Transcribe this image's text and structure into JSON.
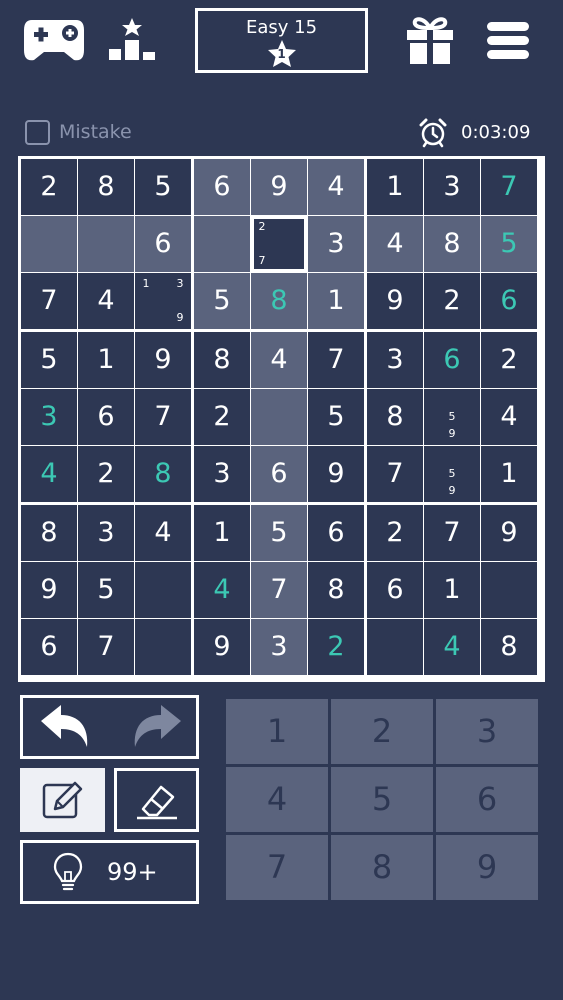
{
  "level": {
    "label": "Easy 15",
    "stars": "1"
  },
  "mistake": {
    "label": "Mistake",
    "checked": false
  },
  "timer": {
    "value": "0:03:09"
  },
  "hint": {
    "count": "99+"
  },
  "numpad": [
    "1",
    "2",
    "3",
    "4",
    "5",
    "6",
    "7",
    "8",
    "9"
  ],
  "icons": [
    "gamepad-icon",
    "leaderboard-icon",
    "gift-icon",
    "menu-icon",
    "alarm-clock-icon",
    "undo-icon",
    "redo-icon",
    "pencil-icon",
    "eraser-icon",
    "lightbulb-icon",
    "star-icon"
  ],
  "colors": {
    "background": "#2d3753",
    "highlight": "#5a637d",
    "user_digit": "#3cc8b4",
    "text": "#ffffff"
  },
  "board": [
    [
      {
        "v": "2"
      },
      {
        "v": "8"
      },
      {
        "v": "5"
      },
      {
        "v": "6",
        "h": 1
      },
      {
        "v": "9",
        "h": 1
      },
      {
        "v": "4",
        "h": 1
      },
      {
        "v": "1"
      },
      {
        "v": "3"
      },
      {
        "v": "7",
        "u": 1
      }
    ],
    [
      {
        "v": "",
        "h": 1
      },
      {
        "v": "",
        "h": 1
      },
      {
        "v": "6",
        "h": 1
      },
      {
        "v": "",
        "h": 1
      },
      {
        "v": "",
        "s": 1,
        "n": [
          "2",
          "",
          "",
          "",
          "",
          "",
          "7",
          "",
          ""
        ]
      },
      {
        "v": "3",
        "h": 1
      },
      {
        "v": "4",
        "h": 1
      },
      {
        "v": "8",
        "h": 1
      },
      {
        "v": "5",
        "u": 1,
        "h": 1
      }
    ],
    [
      {
        "v": "7"
      },
      {
        "v": "4"
      },
      {
        "v": "",
        "n": [
          "1",
          "",
          "3",
          "",
          "",
          "",
          "",
          "",
          "9"
        ]
      },
      {
        "v": "5",
        "h": 1
      },
      {
        "v": "8",
        "u": 1,
        "h": 1
      },
      {
        "v": "1",
        "h": 1
      },
      {
        "v": "9"
      },
      {
        "v": "2"
      },
      {
        "v": "6",
        "u": 1
      }
    ],
    [
      {
        "v": "5"
      },
      {
        "v": "1"
      },
      {
        "v": "9"
      },
      {
        "v": "8"
      },
      {
        "v": "4",
        "h": 1
      },
      {
        "v": "7"
      },
      {
        "v": "3"
      },
      {
        "v": "6",
        "u": 1
      },
      {
        "v": "2"
      }
    ],
    [
      {
        "v": "3",
        "u": 1
      },
      {
        "v": "6"
      },
      {
        "v": "7"
      },
      {
        "v": "2"
      },
      {
        "v": "",
        "h": 1
      },
      {
        "v": "5"
      },
      {
        "v": "8"
      },
      {
        "v": "",
        "n": [
          "",
          "",
          "",
          "",
          "5",
          "",
          "",
          "9",
          ""
        ]
      },
      {
        "v": "4"
      }
    ],
    [
      {
        "v": "4",
        "u": 1
      },
      {
        "v": "2"
      },
      {
        "v": "8",
        "u": 1
      },
      {
        "v": "3"
      },
      {
        "v": "6",
        "h": 1
      },
      {
        "v": "9"
      },
      {
        "v": "7"
      },
      {
        "v": "",
        "n": [
          "",
          "",
          "",
          "",
          "5",
          "",
          "",
          "9",
          ""
        ]
      },
      {
        "v": "1"
      }
    ],
    [
      {
        "v": "8"
      },
      {
        "v": "3"
      },
      {
        "v": "4"
      },
      {
        "v": "1"
      },
      {
        "v": "5",
        "h": 1
      },
      {
        "v": "6"
      },
      {
        "v": "2"
      },
      {
        "v": "7"
      },
      {
        "v": "9"
      }
    ],
    [
      {
        "v": "9"
      },
      {
        "v": "5"
      },
      {
        "v": ""
      },
      {
        "v": "4",
        "u": 1
      },
      {
        "v": "7",
        "h": 1
      },
      {
        "v": "8"
      },
      {
        "v": "6"
      },
      {
        "v": "1"
      },
      {
        "v": ""
      }
    ],
    [
      {
        "v": "6"
      },
      {
        "v": "7"
      },
      {
        "v": ""
      },
      {
        "v": "9"
      },
      {
        "v": "3",
        "h": 1
      },
      {
        "v": "2",
        "u": 1
      },
      {
        "v": ""
      },
      {
        "v": "4",
        "u": 1
      },
      {
        "v": "8"
      }
    ]
  ]
}
